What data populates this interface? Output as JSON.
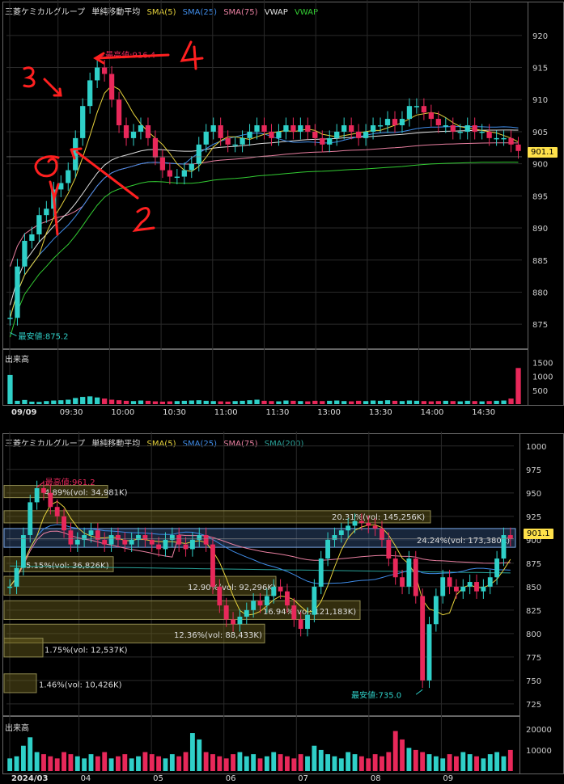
{
  "intraday": {
    "legend": {
      "name": "三菱ケミカルグループ",
      "study": "単純移動平均",
      "sma5": "SMA(5)",
      "sma25": "SMA(25)",
      "sma75": "SMA(75)",
      "vwap1": "VWAP",
      "vwap2": "VWAP"
    },
    "price_tag": "901.1",
    "high_label": "最高値:916.4",
    "low_label": "最安値:875.2",
    "volume_title": "出来高",
    "annotations": [
      "1",
      "2",
      "3",
      "4"
    ]
  },
  "daily": {
    "legend": {
      "name": "三菱ケミカルグループ",
      "study": "単純移動平均",
      "sma5": "SMA(5)",
      "sma25": "SMA(25)",
      "sma75": "SMA(75)",
      "sma200": "SMA(200)"
    },
    "price_tag": "901.1",
    "high_label": "最高値:961.2",
    "low_label": "最安値:735.0",
    "volume_title": "出来高"
  },
  "colors": {
    "up": "#2fd0c8",
    "down": "#e8285a",
    "sma5": "#e6d23c",
    "sma25": "#3f8ce8",
    "sma75": "#e87fa0",
    "vwap": "#e0e0e0",
    "vwap2": "#33cc33",
    "sma200": "#2aa39a",
    "price_tag": "#ffe14a",
    "annotation": "#ff2020"
  },
  "chart_data": [
    {
      "type": "candlestick",
      "title": "三菱ケミカルグループ 単純移動平均 SMA(5) SMA(25) SMA(75) VWAP VWAP",
      "x_ticks": [
        "09/09",
        "09:30",
        "10:00",
        "10:30",
        "11:00",
        "11:30",
        "13:00",
        "13:30",
        "14:00",
        "14:30"
      ],
      "y_ticks": [
        875,
        880,
        885,
        890,
        895,
        900,
        905,
        910,
        915,
        920
      ],
      "ylim": [
        872,
        923
      ],
      "high": 916.4,
      "low": 875.2,
      "last": 901.1,
      "close": [
        876,
        884,
        888,
        889,
        892,
        893,
        896,
        897,
        899,
        904,
        909,
        913,
        915,
        914,
        910,
        906,
        904,
        905,
        906,
        904,
        901,
        899,
        898,
        898,
        899,
        900,
        903,
        905,
        906,
        904,
        903,
        903,
        904,
        905,
        906,
        905,
        904,
        905,
        906,
        905,
        906,
        905,
        904,
        903,
        904,
        905,
        906,
        905,
        904,
        905,
        906,
        906,
        907,
        906,
        907,
        909,
        909,
        908,
        907,
        906,
        906,
        905,
        905,
        906,
        905,
        905,
        904,
        904,
        904,
        903,
        902
      ],
      "volume_ticks": [
        500,
        1000,
        1500
      ],
      "volume_ylim": [
        0,
        1600
      ],
      "volume": [
        1050,
        120,
        150,
        90,
        80,
        110,
        130,
        140,
        160,
        220,
        260,
        280,
        240,
        200,
        160,
        140,
        120,
        110,
        130,
        120,
        100,
        90,
        100,
        110,
        120,
        130,
        140,
        120,
        110,
        100,
        90,
        110,
        120,
        140,
        160,
        120,
        110,
        100,
        130,
        120,
        110,
        100,
        120,
        110,
        120,
        130,
        110,
        100,
        120,
        110,
        130,
        120,
        140,
        120,
        110,
        130,
        120,
        110,
        100,
        110,
        120,
        110,
        100,
        120,
        110,
        100,
        110,
        120,
        130,
        200,
        1300
      ]
    },
    {
      "type": "candlestick",
      "title": "三菱ケミカルグループ 単純移動平均 SMA(5) SMA(25) SMA(75) SMA(200)",
      "x_ticks": [
        "2024/03",
        "04",
        "05",
        "06",
        "07",
        "08",
        "09"
      ],
      "y_ticks": [
        725,
        750,
        775,
        800,
        825,
        850,
        875,
        900,
        925,
        950,
        975,
        1000
      ],
      "ylim": [
        718,
        1005
      ],
      "high": 961.2,
      "low": 735.0,
      "last": 901.1,
      "close": [
        850,
        870,
        905,
        940,
        955,
        950,
        935,
        925,
        910,
        895,
        900,
        905,
        910,
        900,
        895,
        905,
        900,
        895,
        900,
        905,
        900,
        895,
        890,
        900,
        905,
        895,
        890,
        900,
        905,
        895,
        850,
        830,
        815,
        810,
        818,
        825,
        835,
        830,
        840,
        850,
        845,
        830,
        815,
        805,
        820,
        850,
        880,
        900,
        905,
        910,
        915,
        920,
        918,
        915,
        912,
        900,
        880,
        860,
        850,
        880,
        840,
        750,
        810,
        840,
        860,
        850,
        845,
        850,
        855,
        845,
        850,
        860,
        880,
        905,
        901
      ],
      "volume_profile": [
        {
          "label": "4.89%(vol: 34,981K)"
        },
        {
          "label": "20.31%(vol: 145,256K)"
        },
        {
          "label": "24.24%(vol: 173,380K)"
        },
        {
          "label": "5.15%(vol: 36,826K)"
        },
        {
          "label": "12.90%(vol: 92,296K)"
        },
        {
          "label": "16.94%(vol: 121,183K)"
        },
        {
          "label": "12.36%(vol: 88,433K)"
        },
        {
          "label": "1.75%(vol: 12,537K)"
        },
        {
          "label": "1.46%(vol: 10,426K)"
        }
      ],
      "volume_ticks": [
        10000,
        20000
      ],
      "volume_ylim": [
        0,
        23000
      ],
      "volume": [
        6000,
        7000,
        12000,
        16000,
        9000,
        8000,
        7000,
        6000,
        9000,
        8000,
        7000,
        6000,
        8000,
        7000,
        9000,
        6000,
        7000,
        8000,
        6000,
        7000,
        9000,
        8000,
        7000,
        6000,
        8000,
        7000,
        9000,
        18000,
        15000,
        9000,
        8000,
        7000,
        6000,
        8000,
        9000,
        7000,
        8000,
        6000,
        7000,
        9000,
        8000,
        7000,
        6000,
        8000,
        7000,
        12000,
        10000,
        8000,
        7000,
        6000,
        9000,
        8000,
        7000,
        6000,
        8000,
        7000,
        9000,
        19000,
        15000,
        11000,
        10000,
        9000,
        8000,
        7000,
        6000,
        8000,
        7000,
        9000,
        8000,
        7000,
        6000,
        8000,
        9000,
        7000,
        10000
      ]
    }
  ]
}
